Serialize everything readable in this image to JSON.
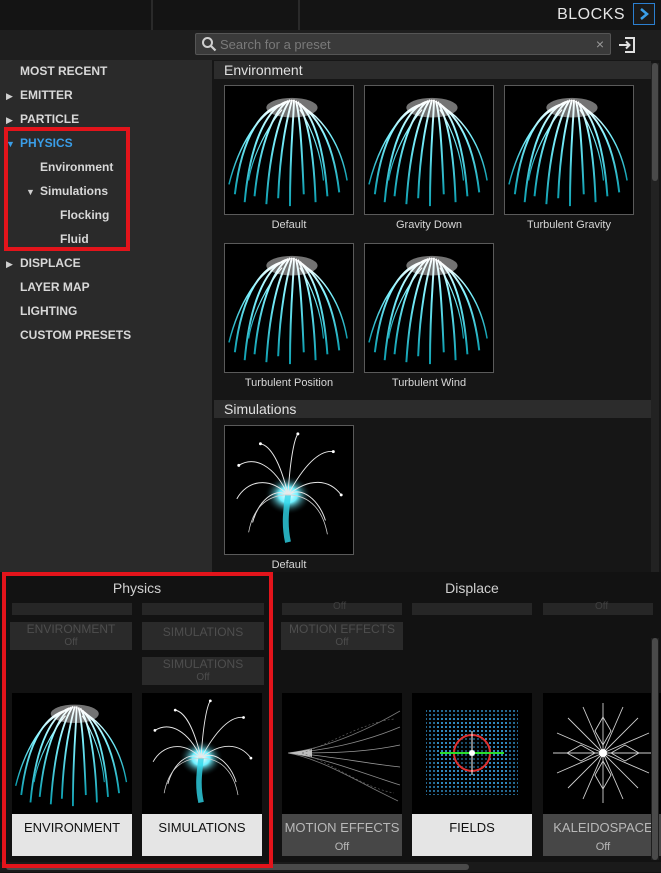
{
  "topbar": {
    "title": "BLOCKS"
  },
  "search": {
    "placeholder": "Search for a preset",
    "clear": "×"
  },
  "tree": {
    "items": [
      {
        "label": "MOST RECENT"
      },
      {
        "label": "EMITTER",
        "arrow": "▶"
      },
      {
        "label": "PARTICLE",
        "arrow": "▶"
      },
      {
        "label": "PHYSICS",
        "arrow": "▼"
      },
      {
        "label": "Environment"
      },
      {
        "label": "Simulations",
        "arrow": "▼"
      },
      {
        "label": "Flocking"
      },
      {
        "label": "Fluid"
      },
      {
        "label": "DISPLACE",
        "arrow": "▶"
      },
      {
        "label": "LAYER MAP"
      },
      {
        "label": "LIGHTING"
      },
      {
        "label": "CUSTOM PRESETS"
      }
    ]
  },
  "grid": {
    "sections": [
      {
        "title": "Environment",
        "presets": [
          "Default",
          "Gravity Down",
          "Turbulent Gravity",
          "Turbulent Position",
          "Turbulent Wind"
        ]
      },
      {
        "title": "Simulations",
        "presets": [
          "Default"
        ]
      }
    ]
  },
  "bottom": {
    "tabs": [
      "Physics",
      "Displace"
    ],
    "faded": {
      "environment": "ENVIRONMENT",
      "simulations": "SIMULATIONS",
      "motion_effects": "MOTION EFFECTS",
      "off": "Off"
    },
    "blocks": [
      {
        "name": "ENVIRONMENT",
        "state": ""
      },
      {
        "name": "SIMULATIONS",
        "state": ""
      },
      {
        "name": "MOTION EFFECTS",
        "state": "Off"
      },
      {
        "name": "FIELDS",
        "state": ""
      },
      {
        "name": "KALEIDOSPACE",
        "state": "Off"
      }
    ]
  },
  "colors": {
    "accent": "#3a9ee8",
    "highlight": "#e3141b",
    "particle": "#3fe6ff"
  }
}
